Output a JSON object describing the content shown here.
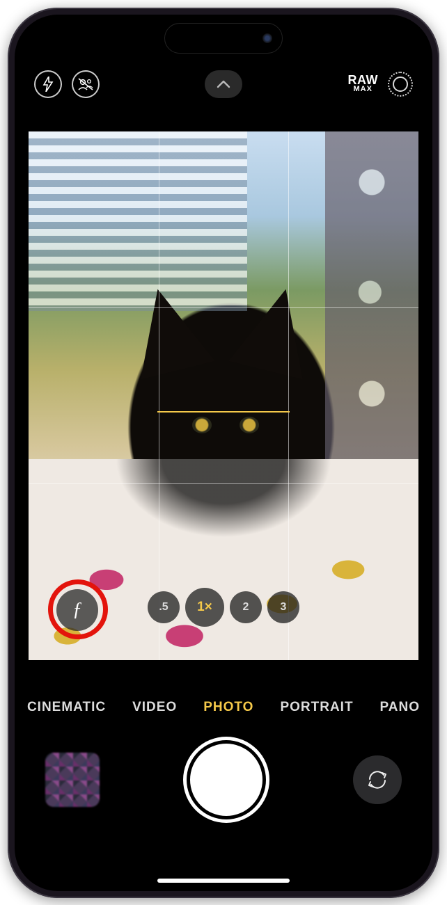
{
  "app": "Camera",
  "top_controls": {
    "flash_icon": "flash-off-icon",
    "shared_library_icon": "shared-library-off-icon",
    "chevron_icon": "chevron-up-icon",
    "raw_label_top": "RAW",
    "raw_label_sub": "MAX",
    "live_photo_icon": "live-photo-icon"
  },
  "viewfinder": {
    "subject": "black cat on pink and yellow blanket, window with blinds behind, patterned curtain on right",
    "grid_enabled": true,
    "level_indicator_visible": true
  },
  "aperture_button": {
    "symbol": "ƒ",
    "highlighted": true
  },
  "zoom": {
    "options": [
      {
        "label": ".5",
        "active": false
      },
      {
        "label": "1×",
        "active": true
      },
      {
        "label": "2",
        "active": false
      },
      {
        "label": "3",
        "active": false
      }
    ]
  },
  "modes": [
    {
      "label": "CINEMATIC",
      "active": false
    },
    {
      "label": "VIDEO",
      "active": false
    },
    {
      "label": "PHOTO",
      "active": true
    },
    {
      "label": "PORTRAIT",
      "active": false
    },
    {
      "label": "PANO",
      "active": false
    }
  ],
  "bottom": {
    "thumbnail_label": "last-photo-thumbnail",
    "shutter_label": "shutter-button",
    "switch_cam_label": "switch-camera-button"
  }
}
